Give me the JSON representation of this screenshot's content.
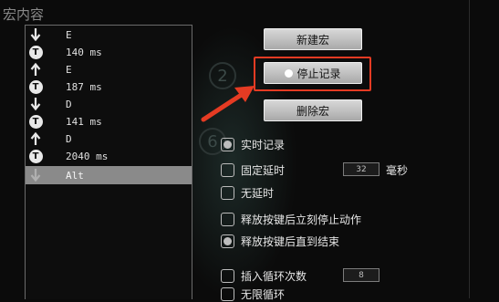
{
  "section": {
    "title": "宏内容"
  },
  "macro_list": [
    {
      "icon": "down-arrow-icon",
      "text": "E"
    },
    {
      "icon": "timer-icon",
      "text": "140 ms"
    },
    {
      "icon": "up-arrow-icon",
      "text": "E"
    },
    {
      "icon": "timer-icon",
      "text": "187 ms"
    },
    {
      "icon": "down-arrow-icon",
      "text": "D"
    },
    {
      "icon": "timer-icon",
      "text": "141 ms"
    },
    {
      "icon": "up-arrow-icon",
      "text": "D"
    },
    {
      "icon": "timer-icon",
      "text": "2040 ms"
    },
    {
      "icon": "down-arrow-icon",
      "text": "Alt",
      "selected": true
    }
  ],
  "timer_badge": "T",
  "buttons": {
    "new": "新建宏",
    "stop_record": "停止记录",
    "delete": "删除宏"
  },
  "background_numbers": [
    "2",
    "6"
  ],
  "options": {
    "realtime_record": "实时记录",
    "fixed_delay": "固定延时",
    "fixed_delay_value": "32",
    "fixed_delay_unit": "毫秒",
    "no_delay": "无延时",
    "release_stop": "释放按键后立刻停止动作",
    "release_until_end": "释放按键后直到结束",
    "loop_count": "插入循环次数",
    "loop_count_value": "8",
    "infinite_loop": "无限循环"
  },
  "colors": {
    "highlight": "#e53b23",
    "selected_row": "#8a8a8a"
  }
}
